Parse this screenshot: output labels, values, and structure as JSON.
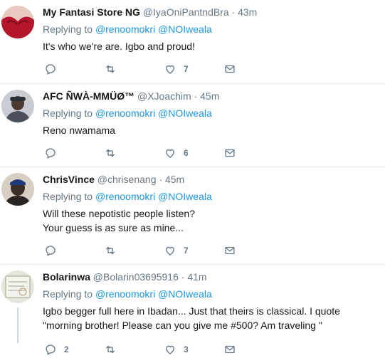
{
  "tweets": [
    {
      "name": "My Fantasi Store NG",
      "handle": "@IyaOniPantndBra",
      "time": "43m",
      "replying_label": "Replying to",
      "mention1": "@renoomokri",
      "mention2": "@NOIweala",
      "text": "It's who we're are. Igbo and proud!",
      "reply_count": "",
      "retweet_count": "",
      "like_count": "7",
      "avatar_color": "#b5162b"
    },
    {
      "name": "AFC ÑWÀ-MMÜØ™",
      "handle": "@XJoachim",
      "time": "45m",
      "replying_label": "Replying to",
      "mention1": "@renoomokri",
      "mention2": "@NOIweala",
      "text": "Reno nwamama",
      "reply_count": "",
      "retweet_count": "",
      "like_count": "6",
      "avatar_color": "#4a4f5a"
    },
    {
      "name": "ChrisVince",
      "handle": "@chrisenang",
      "time": "45m",
      "replying_label": "Replying to",
      "mention1": "@renoomokri",
      "mention2": "@NOIweala",
      "text": "Will these nepotistic people listen?\nYour guess is as sure as mine...",
      "reply_count": "",
      "retweet_count": "",
      "like_count": "7",
      "avatar_color": "#3b2f2a"
    },
    {
      "name": "Bolarinwa",
      "handle": "@Bolarin03695916",
      "time": "41m",
      "replying_label": "Replying to",
      "mention1": "@renoomokri",
      "mention2": "@NOIweala",
      "text": "Igbo begger full here in Ibadan... Just that theirs is classical. I quote \"morning brother! Please can you give me #500? Am traveling \"",
      "reply_count": "2",
      "retweet_count": "",
      "like_count": "3",
      "avatar_color": "#9aa48a"
    }
  ],
  "colors": {
    "link": "#1b95e0",
    "muted": "#657786",
    "divider": "#e6ecf0"
  }
}
